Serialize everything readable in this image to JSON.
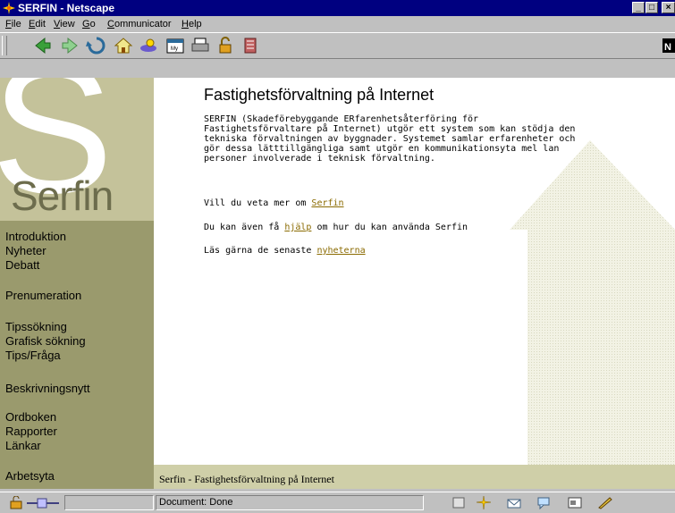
{
  "window": {
    "title": "SERFIN - Netscape",
    "controls": [
      "minimize",
      "maximize",
      "close"
    ]
  },
  "menu": {
    "file": {
      "u": "F",
      "rest": "ile"
    },
    "edit": {
      "u": "E",
      "rest": "dit"
    },
    "view": {
      "u": "V",
      "rest": "iew"
    },
    "go": {
      "u": "G",
      "rest": "o"
    },
    "communicator": {
      "u": "C",
      "rest": "ommunicator"
    },
    "help": {
      "u": "H",
      "rest": "elp"
    }
  },
  "toolbar": {
    "icons": [
      "back-icon",
      "forward-icon",
      "reload-icon",
      "home-icon",
      "search-icon",
      "my-netscape-icon",
      "print-icon",
      "security-icon",
      "stop-icon"
    ]
  },
  "sidebar": {
    "logo_letter": "S",
    "logo_word": "Serfin",
    "nav": {
      "introduktion": "Introduktion",
      "nyheter": "Nyheter",
      "debatt": "Debatt",
      "prenumeration": "Prenumeration",
      "tipssokning": "Tipssökning",
      "grafisk_sokning": "Grafisk sökning",
      "tips_fraga": "Tips/Fråga",
      "beskrivningsnytt": "Beskrivningsnytt",
      "ordboken": "Ordboken",
      "rapporter": "Rapporter",
      "lankar": "Länkar",
      "arbetsyta": "Arbetsyta"
    }
  },
  "main": {
    "heading": "Fastighetsförvaltning på Internet",
    "intro": "SERFIN (Skadeförebyggande ERfarenhetsåterföring för Fastighetsförvaltare på Internet) utgör ett system som kan stödja den tekniska förvaltningen av byggnader. Systemet samlar erfarenheter och gör dessa lätttillgängliga samt utgör en kommunikationsyta mel lan personer involverade i teknisk förvaltning.",
    "line1_prefix": "Vill du veta mer om ",
    "line1_link": "Serfin",
    "line2_prefix": "Du kan även få ",
    "line2_link": "hjälp",
    "line2_suffix": " om hur du kan använda Serfin",
    "line3_prefix": "Läs gärna de senaste ",
    "line3_link": "nyheterna"
  },
  "footer": {
    "text": "Serfin - Fastighetsförvaltning på Internet"
  },
  "statusbar": {
    "text": "Document: Done"
  },
  "colors": {
    "titlebar": "#000080",
    "sidebar_light": "#c4c29a",
    "sidebar_dark": "#9a9a6d",
    "footer": "#cfcfa8",
    "link": "#8a6a00"
  }
}
